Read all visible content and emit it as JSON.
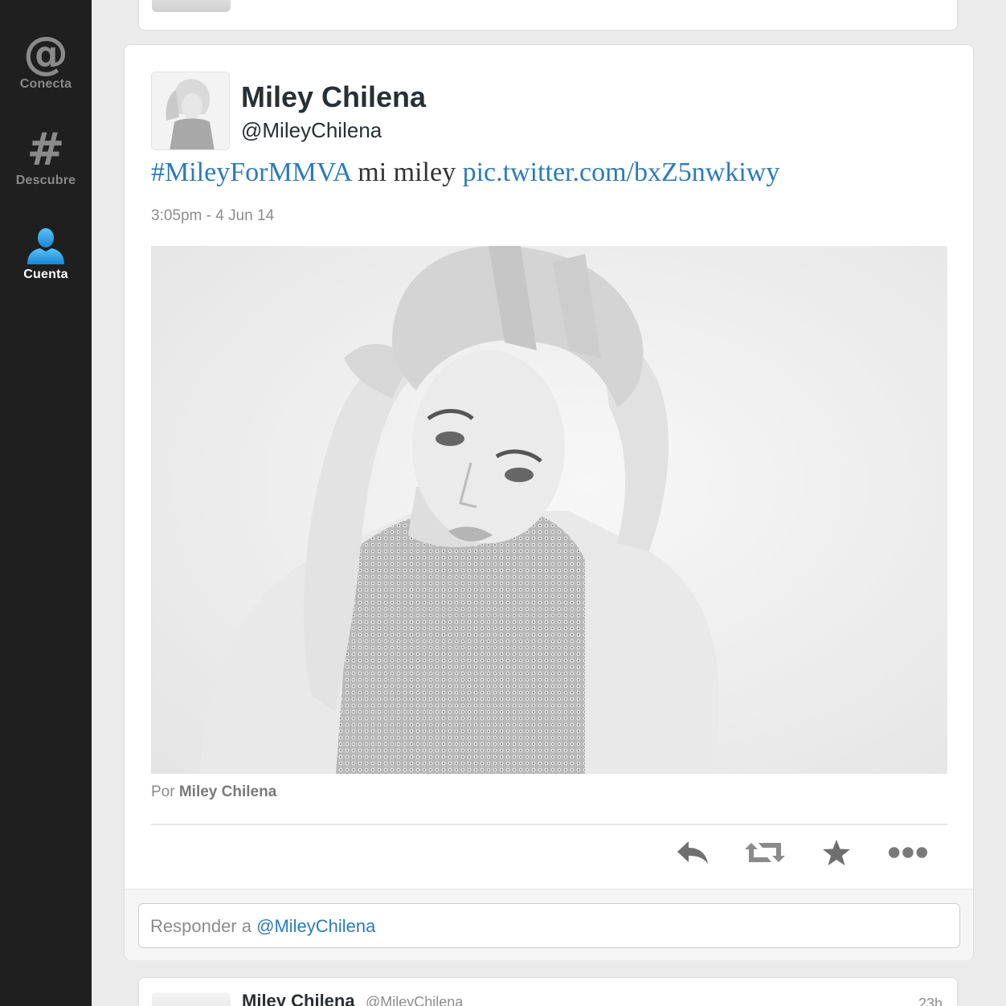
{
  "sidebar": {
    "items": [
      {
        "label": "Conecta",
        "icon": "at-icon"
      },
      {
        "label": "Descubre",
        "icon": "hashtag-icon"
      },
      {
        "label": "Cuenta",
        "icon": "user-icon"
      }
    ],
    "active_color": "#ffffff",
    "accent": "#2aa1e6"
  },
  "tweet": {
    "name": "Miley Chilena",
    "handle": "@MileyChilena",
    "text": {
      "hashtag": "#MileyForMMVA",
      "body": "mi miley",
      "link": "pic.twitter.com/bxZ5nwkiwy"
    },
    "timestamp": "3:05pm - 4 Jun 14",
    "media_credit_prefix": "Por",
    "media_credit_name": "Miley Chilena",
    "actions": [
      "reply-icon",
      "retweet-icon",
      "favorite-star-icon",
      "more-icon"
    ]
  },
  "reply": {
    "prefix": "Responder a",
    "mention": "@MileyChilena"
  },
  "next_tweet": {
    "name": "Miley Chilena",
    "handle": "@MileyChilena",
    "time": "23h"
  },
  "colors": {
    "link": "#2b7bb9",
    "sidebar_bg": "#1f1f1f"
  }
}
